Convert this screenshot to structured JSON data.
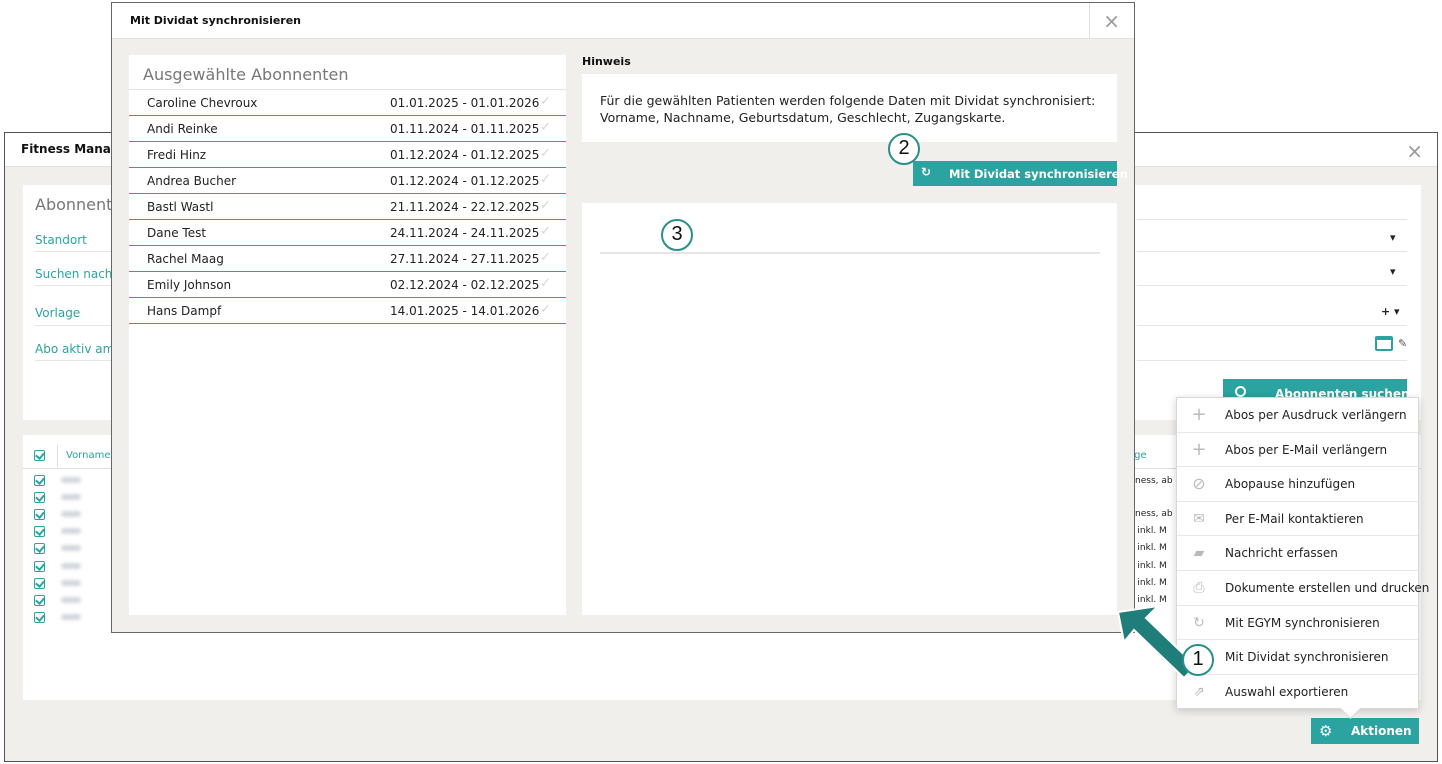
{
  "background_window": {
    "title": "Fitness Manager",
    "close": "×",
    "filter": {
      "title": "Abonnenten",
      "fields": [
        "Standort",
        "Suchen nach",
        "Vorlage",
        "Abo aktiv am"
      ],
      "search_button": "Abonnenten suchen"
    },
    "grid": {
      "col_vorname": "Vorname",
      "col_right": "age",
      "right_cells": [
        "itness, ab",
        "itness, ab",
        "e inkl. M",
        "e inkl. M",
        "e inkl. M",
        "e inkl. M",
        "e inkl. M"
      ]
    },
    "actions_button": "Aktionen"
  },
  "actions_menu": {
    "items": [
      {
        "label": "Abos per Ausdruck verlängern",
        "icon": "plus-icon"
      },
      {
        "label": "Abos per E-Mail verlängern",
        "icon": "plus-icon"
      },
      {
        "label": "Abopause hinzufügen",
        "icon": "pause-circle-icon"
      },
      {
        "label": "Per E-Mail kontaktieren",
        "icon": "envelope-icon"
      },
      {
        "label": "Nachricht erfassen",
        "icon": "chat-icon"
      },
      {
        "label": "Dokumente erstellen und drucken",
        "icon": "printer-icon"
      },
      {
        "label": "Mit EGYM synchronisieren",
        "icon": "sync-icon"
      },
      {
        "label": "Mit Dividat synchronisieren",
        "icon": "none"
      },
      {
        "label": "Auswahl exportieren",
        "icon": "export-icon"
      }
    ]
  },
  "modal": {
    "title": "Mit Dividat synchronisieren",
    "close": "×",
    "subscribers_title": "Ausgewählte Abonnenten",
    "subscribers": [
      {
        "name": "Caroline Chevroux",
        "period": "01.01.2025 - 01.01.2026"
      },
      {
        "name": "Andi Reinke",
        "period": "01.11.2024 - 01.11.2025"
      },
      {
        "name": "Fredi Hinz",
        "period": "01.12.2024 - 01.12.2025"
      },
      {
        "name": "Andrea Bucher",
        "period": "01.12.2024 - 01.12.2025"
      },
      {
        "name": "Bastl Wastl",
        "period": "21.11.2024 - 22.12.2025"
      },
      {
        "name": "Dane Test",
        "period": "24.11.2024 - 24.11.2025"
      },
      {
        "name": "Rachel Maag",
        "period": "27.11.2024 - 27.11.2025"
      },
      {
        "name": "Emily Johnson",
        "period": "02.12.2024 - 02.12.2025"
      },
      {
        "name": "Hans Dampf",
        "period": "14.01.2025 - 14.01.2026"
      }
    ],
    "hint_label": "Hinweis",
    "hint_line1": "Für die gewählten Patienten werden folgende Daten mit Dividat synchronisiert:",
    "hint_line2": "Vorname, Nachname, Geburtsdatum, Geschlecht, Zugangskarte.",
    "sync_button": "Mit Dividat synchronisieren"
  },
  "callouts": [
    "1",
    "2",
    "3"
  ],
  "colors": {
    "accent": "#2ba3a0",
    "arrow": "#1f7e79",
    "panel_bg": "#f1efec"
  }
}
